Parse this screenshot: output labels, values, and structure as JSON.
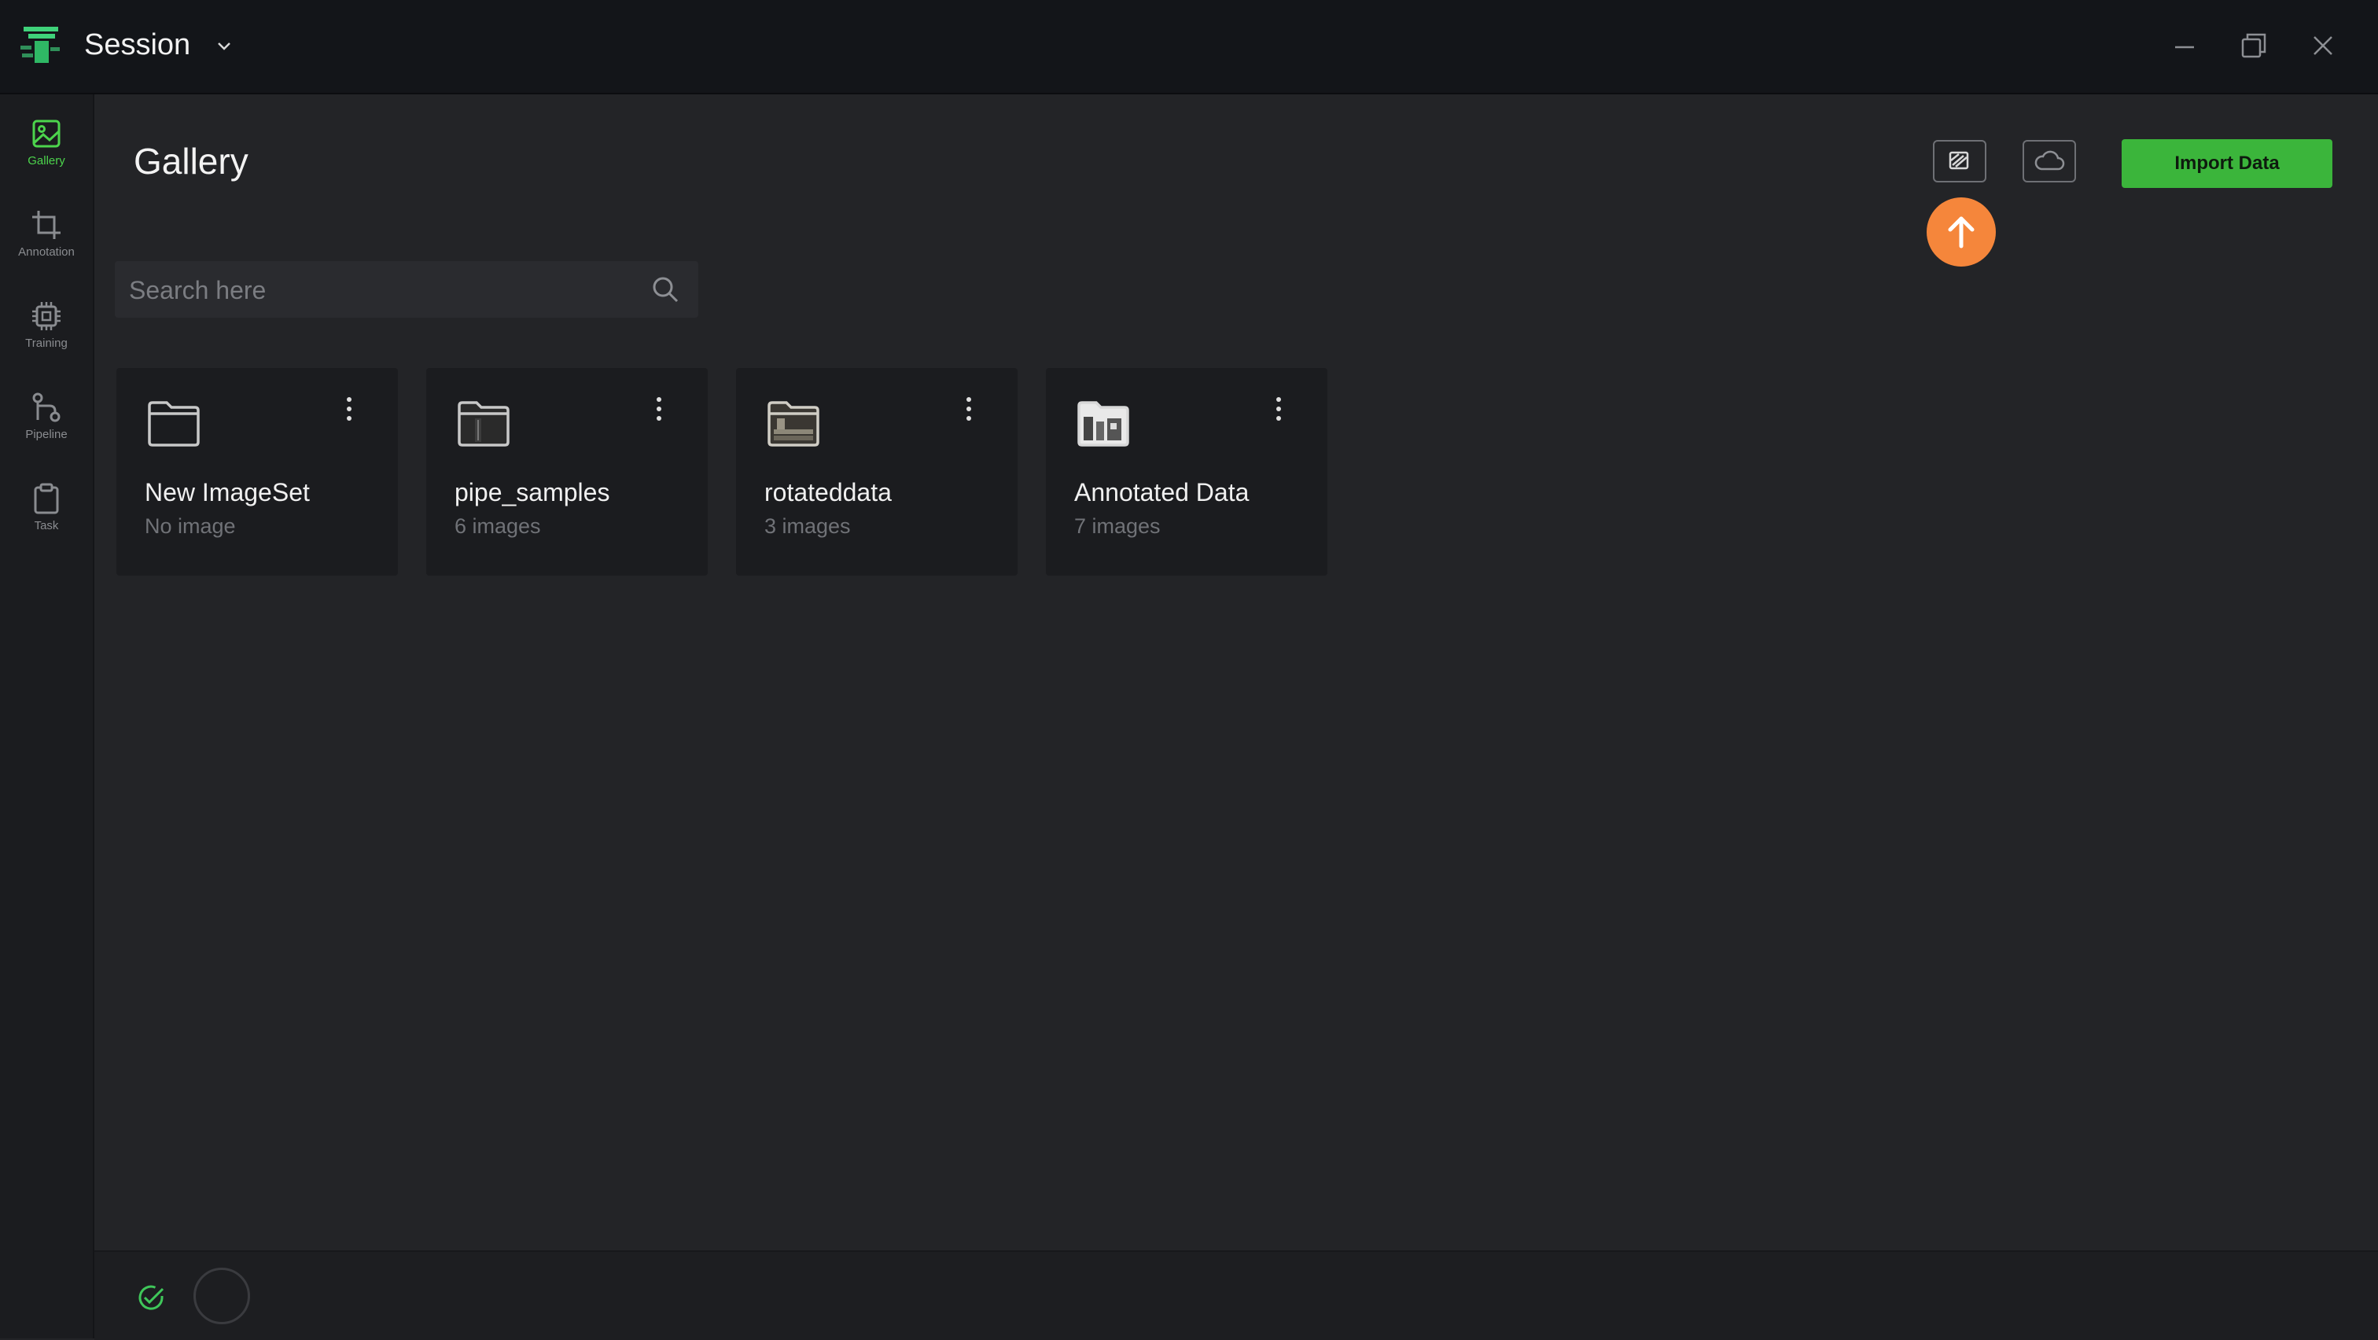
{
  "app": {
    "title": "Session"
  },
  "sidebar": {
    "items": [
      {
        "label": "Gallery",
        "icon": "gallery-icon",
        "active": true
      },
      {
        "label": "Annotation",
        "icon": "crop-icon",
        "active": false
      },
      {
        "label": "Training",
        "icon": "chip-icon",
        "active": false
      },
      {
        "label": "Pipeline",
        "icon": "pipeline-icon",
        "active": false
      },
      {
        "label": "Task",
        "icon": "clipboard-icon",
        "active": false
      }
    ]
  },
  "main": {
    "title": "Gallery",
    "import_label": "Import Data",
    "search": {
      "placeholder": "Search here",
      "value": ""
    },
    "image_sets": [
      {
        "name": "New ImageSet",
        "count": "No image",
        "icon": "folder-icon"
      },
      {
        "name": "pipe_samples",
        "count": "6 images",
        "icon": "folder-thumbnail-icon"
      },
      {
        "name": "rotateddata",
        "count": "3 images",
        "icon": "folder-thumbnail-icon"
      },
      {
        "name": "Annotated Data",
        "count": "7 images",
        "icon": "folder-thumbnail-icon"
      }
    ]
  },
  "colors": {
    "accent": "#3bb53b",
    "active_nav": "#4cd44c",
    "upload_hint": "#f5863b",
    "background": "#232427",
    "titlebar": "#131519",
    "card": "#1b1c1f"
  }
}
